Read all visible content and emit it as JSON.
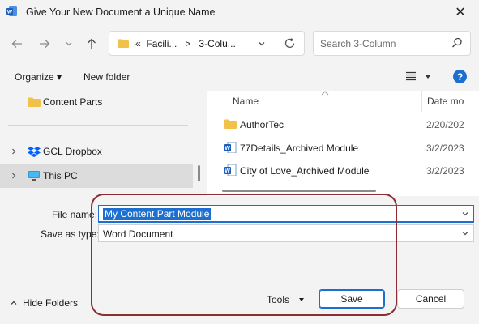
{
  "window": {
    "title": "Give Your New Document a Unique Name",
    "close_glyph": "✕"
  },
  "address": {
    "crumb_prefix": "«",
    "crumb_1": "Facili...",
    "separator": ">",
    "crumb_2": "3-Colu..."
  },
  "search": {
    "placeholder": "Search 3-Column"
  },
  "toolbar": {
    "organize_label": "Organize ▾",
    "new_folder_label": "New folder",
    "help_label": "?"
  },
  "nav_pane": {
    "items": [
      {
        "label": "Content Parts",
        "icon": "folder-icon"
      },
      {
        "label": "GCL Dropbox",
        "icon": "dropbox-icon"
      },
      {
        "label": "This PC",
        "icon": "monitor-icon"
      }
    ]
  },
  "file_list": {
    "columns": [
      "Name",
      "Date mo"
    ],
    "rows": [
      {
        "name": "AuthorTec",
        "date": "2/20/202",
        "icon": "folder-icon"
      },
      {
        "name": "77Details_Archived Module",
        "date": "3/2/2023",
        "icon": "word-doc-icon"
      },
      {
        "name": "City of Love_Archived Module",
        "date": "3/2/2023",
        "icon": "word-doc-icon"
      }
    ]
  },
  "form": {
    "file_name_label": "File name:",
    "file_name_value": "My Content Part Module",
    "save_type_label": "Save as type:",
    "save_type_value": "Word Document"
  },
  "footer": {
    "hide_folders_label": "Hide Folders",
    "tools_label": "Tools",
    "save_label": "Save",
    "cancel_label": "Cancel"
  },
  "colors": {
    "accent": "#1d6fcf",
    "annotation": "#8b2d37",
    "folder": "#f0c24a"
  }
}
